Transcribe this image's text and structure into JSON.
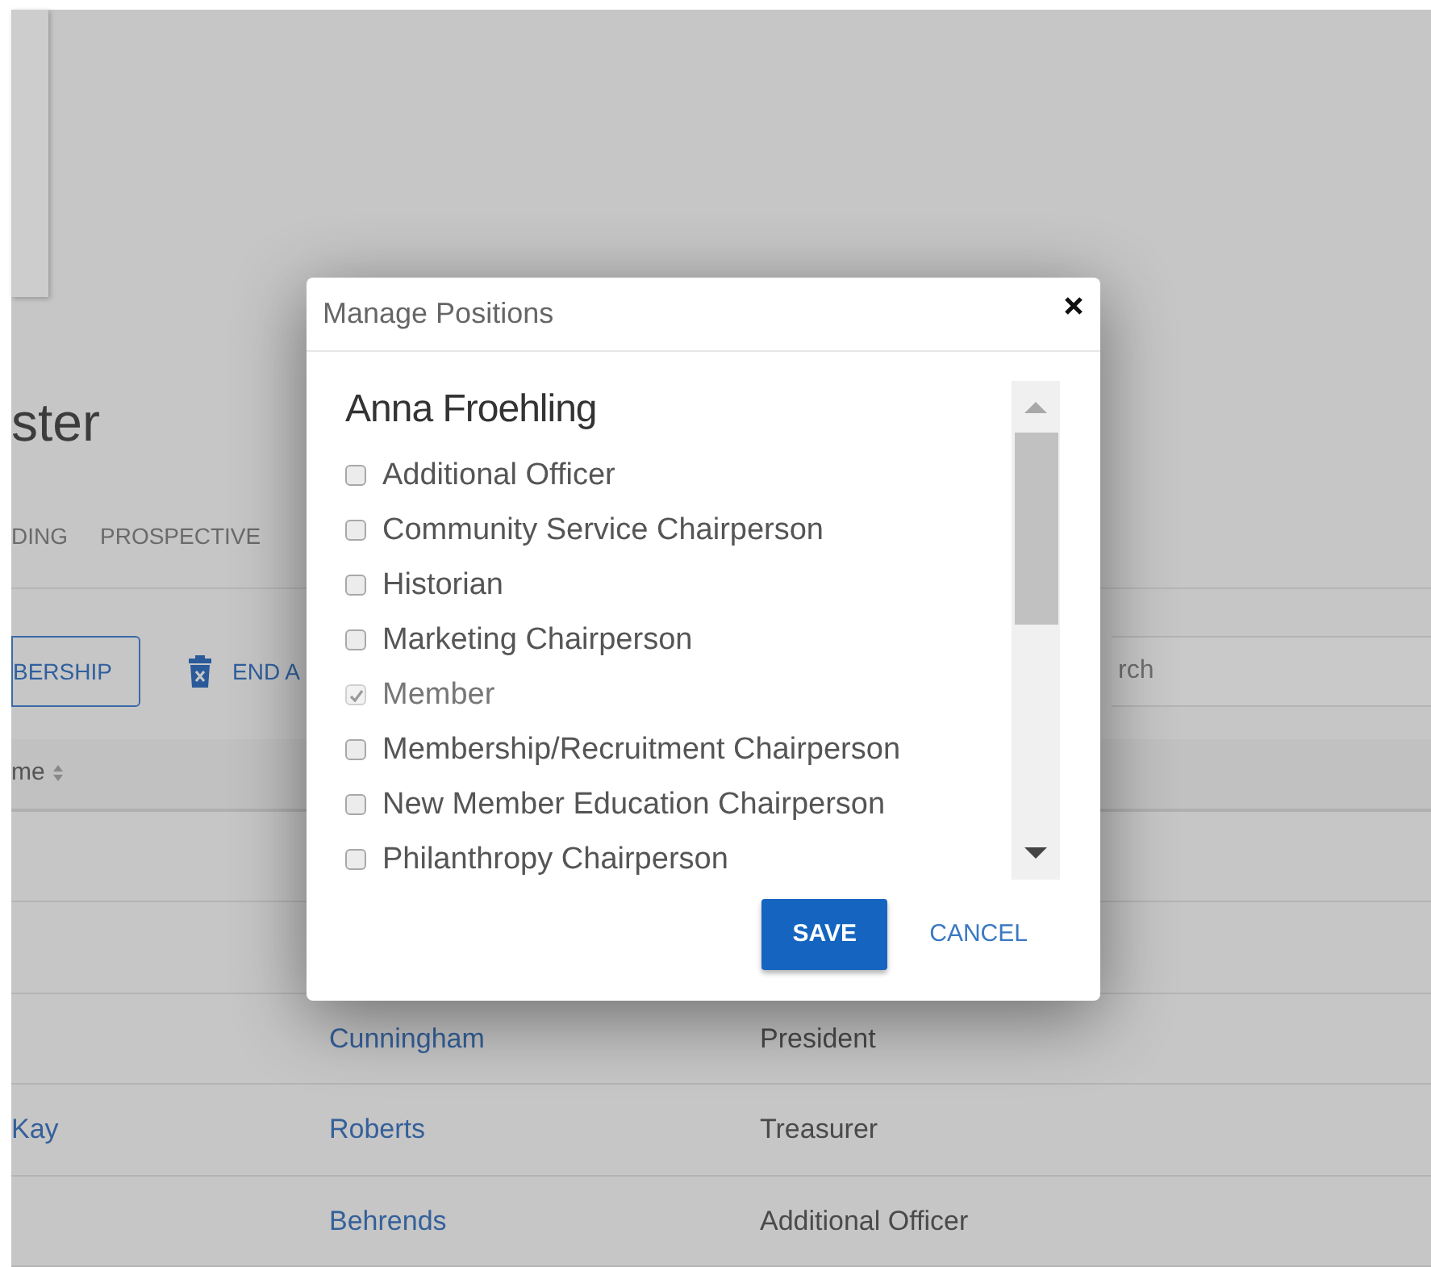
{
  "page": {
    "heading": "ster",
    "tabs": [
      {
        "label": "DING",
        "selected": false
      },
      {
        "label": "PROSPECTIVE",
        "selected": false
      }
    ],
    "toolbar": {
      "membership_button": "BERSHIP",
      "end_button": "END A",
      "search": {
        "placeholder": "rch"
      }
    },
    "table": {
      "columns": [
        "me"
      ],
      "rows": [
        {},
        {},
        {
          "last": "Cunningham",
          "position": "President"
        },
        {
          "first": "Kay",
          "last": "Roberts",
          "position": "Treasurer"
        },
        {
          "last": "Behrends",
          "position": "Additional Officer"
        }
      ]
    }
  },
  "dialog": {
    "title": "Manage Positions",
    "member_name": "Anna Froehling",
    "positions": [
      {
        "label": "Additional Officer",
        "checked": false,
        "disabled": false
      },
      {
        "label": "Community Service Chairperson",
        "checked": false,
        "disabled": false
      },
      {
        "label": "Historian",
        "checked": false,
        "disabled": false
      },
      {
        "label": "Marketing Chairperson",
        "checked": false,
        "disabled": false
      },
      {
        "label": "Member",
        "checked": true,
        "disabled": true
      },
      {
        "label": "Membership/Recruitment Chairperson",
        "checked": false,
        "disabled": false
      },
      {
        "label": "New Member Education Chairperson",
        "checked": false,
        "disabled": false
      },
      {
        "label": "Philanthropy Chairperson",
        "checked": false,
        "disabled": false
      }
    ],
    "save": "SAVE",
    "cancel": "CANCEL"
  }
}
